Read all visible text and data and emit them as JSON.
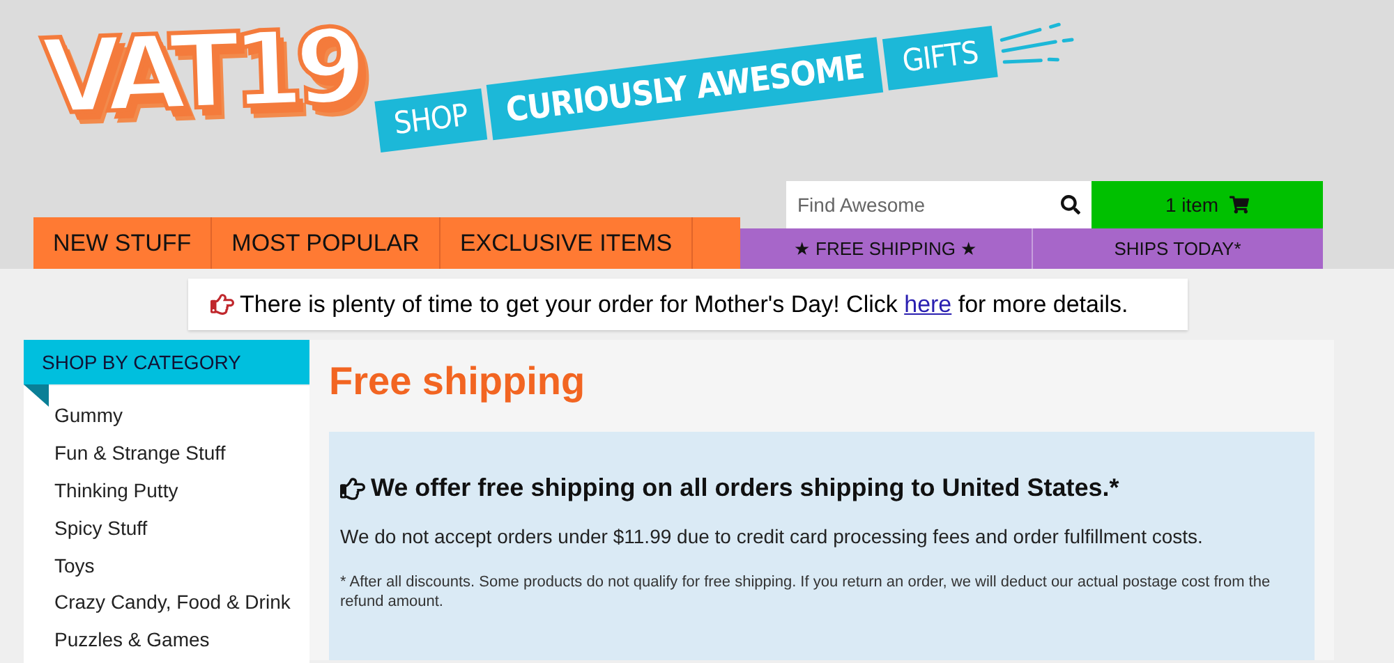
{
  "logo": {
    "wordmark": "VAT19",
    "ribbon": [
      "SHOP",
      "CURIOUSLY AWESOME",
      "GIFTS"
    ]
  },
  "nav": [
    {
      "label": "NEW STUFF"
    },
    {
      "label": "MOST POPULAR"
    },
    {
      "label": "EXCLUSIVE ITEMS"
    }
  ],
  "search": {
    "placeholder": "Find Awesome"
  },
  "cart": {
    "label": "1 item"
  },
  "promo_bar": [
    "★ FREE SHIPPING ★",
    "SHIPS TODAY*"
  ],
  "notice": {
    "before": "There is plenty of time to get your order for Mother's Day! Click",
    "link": "here",
    "after": "for more details."
  },
  "sidebar": {
    "heading": "SHOP BY CATEGORY",
    "items": [
      "Gummy",
      "Fun & Strange Stuff",
      "Thinking Putty",
      "Spicy Stuff",
      "Toys",
      "Crazy Candy, Food & Drink",
      "Puzzles & Games"
    ]
  },
  "main": {
    "title": "Free shipping",
    "box": {
      "heading": "We offer free shipping on all orders shipping to United States.*",
      "body": "We do not accept orders under $11.99 due to credit card processing fees and order fulfillment costs.",
      "footnote": "* After all discounts. Some products do not qualify for free shipping. If you return an order, we will deduct our actual postage cost from the refund amount."
    }
  }
}
